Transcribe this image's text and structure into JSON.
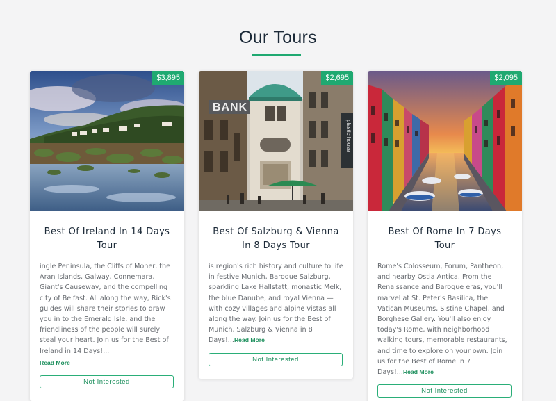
{
  "page": {
    "title": "Our Tours"
  },
  "colors": {
    "accent": "#1fa971",
    "title": "#1c2a38",
    "text": "#676b70"
  },
  "tours": [
    {
      "price": "$3,895",
      "title": "Best Of Ireland In 14 Days Tour",
      "text": "ingle Peninsula, the Cliffs of Moher, the Aran Islands, Galway, Connemara, Giant's Causeway, and the compelling city of Belfast. All along the way, Rick's guides will share their stories to draw you in to the Emerald Isle, and the friendliness of the people will surely steal your heart. Join us for the Best of Ireland in 14 Days!...",
      "read_more": "Read More",
      "button": "Not Interested"
    },
    {
      "price": "$2,695",
      "title": "Best Of Salzburg & Vienna In 8 Days Tour",
      "text": "is region's rich history and culture to life in festive Munich, Baroque Salzburg, sparkling Lake Hallstatt, monastic Melk, the blue Danube, and royal Vienna — with cozy villages and alpine vistas all along the way. Join us for the Best of Munich, Salzburg & Vienna in 8 Days!...",
      "read_more": "Read More",
      "button": "Not Interested",
      "image_sign_bank": "BANK",
      "image_sign_plastic": "plastic house"
    },
    {
      "price": "$2,095",
      "title": "Best Of Rome In 7 Days Tour",
      "text": "Rome's Colosseum, Forum, Pantheon, and nearby Ostia Antica. From the Renaissance and Baroque eras, you'll marvel at St. Peter's Basilica, the Vatican Museums, Sistine Chapel, and Borghese Gallery. You'll also enjoy today's Rome, with neighborhood walking tours, memorable restaurants, and time to explore on your own. Join us for the Best of Rome in 7 Days!...",
      "read_more": "Read More",
      "button": "Not Interested"
    }
  ]
}
